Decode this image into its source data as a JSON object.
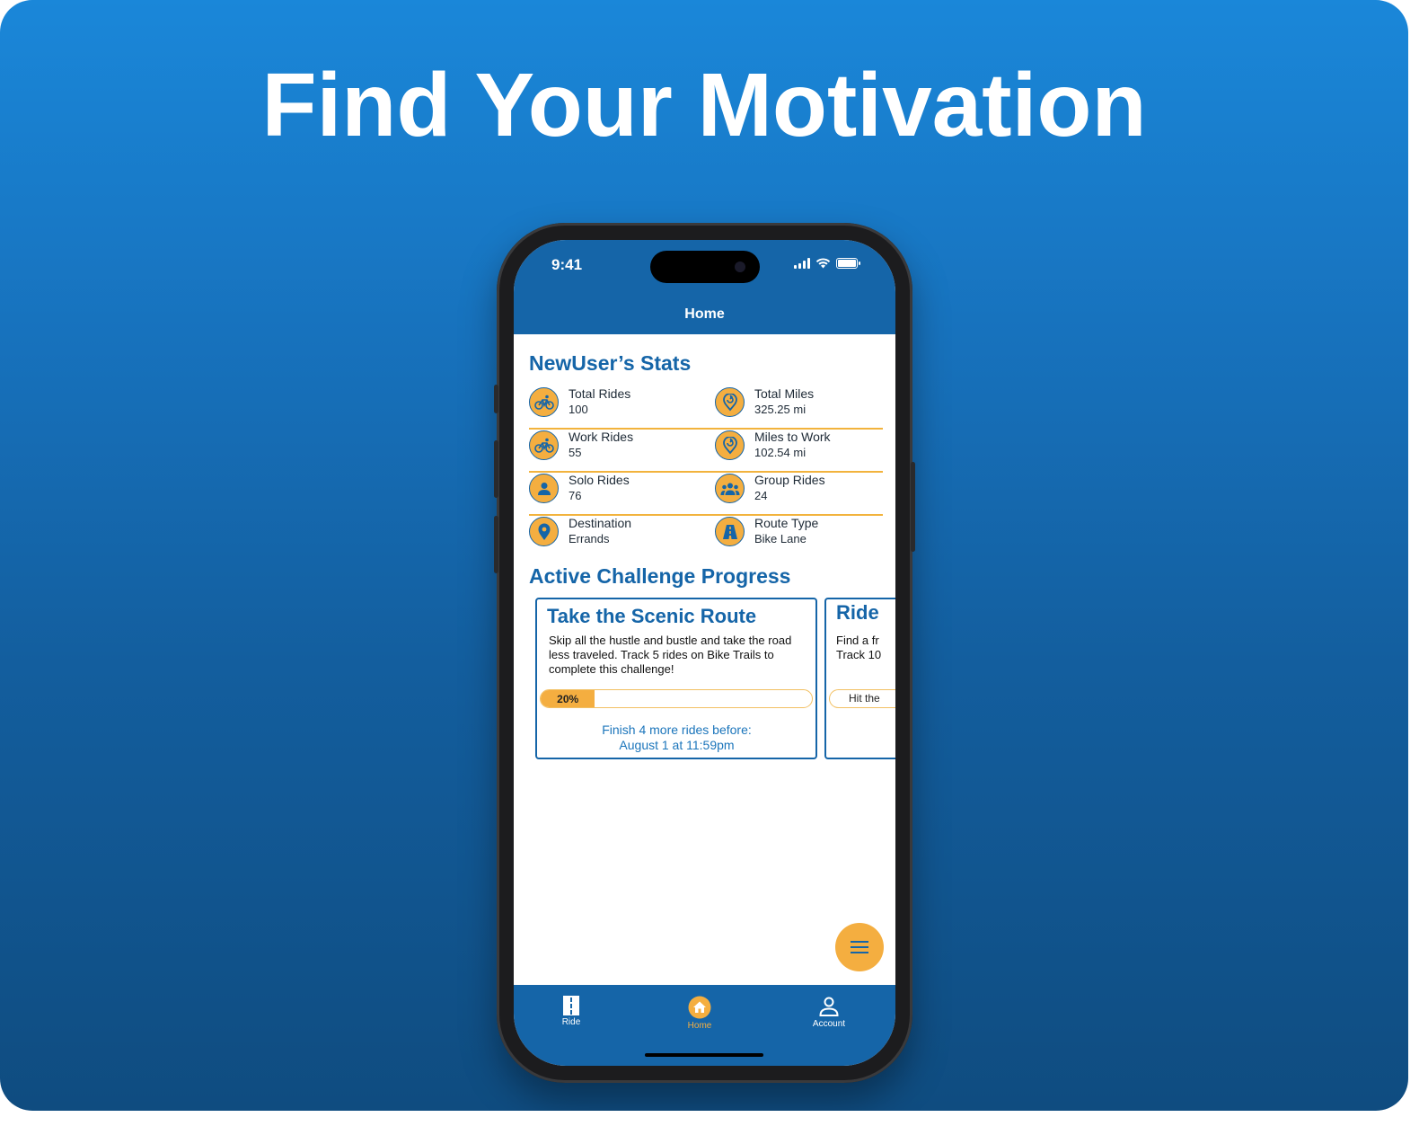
{
  "headline": "Find Your Motivation",
  "status_bar": {
    "time": "9:41"
  },
  "nav": {
    "title": "Home"
  },
  "stats": {
    "title": "NewUser’s Stats",
    "items": [
      {
        "label": "Total Rides",
        "value": "100",
        "icon": "bike-icon"
      },
      {
        "label": "Total Miles",
        "value": "325.25 mi",
        "icon": "location-refresh-icon"
      },
      {
        "label": "Work Rides",
        "value": "55",
        "icon": "bike-icon"
      },
      {
        "label": "Miles to Work",
        "value": "102.54 mi",
        "icon": "location-refresh-icon"
      },
      {
        "label": "Solo Rides",
        "value": "76",
        "icon": "person-icon"
      },
      {
        "label": "Group Rides",
        "value": "24",
        "icon": "group-icon"
      },
      {
        "label": "Destination",
        "value": "Errands",
        "icon": "map-pin-icon"
      },
      {
        "label": "Route Type",
        "value": "Bike Lane",
        "icon": "road-icon"
      }
    ]
  },
  "challenges": {
    "title": "Active Challenge Progress",
    "cards": [
      {
        "title": "Take the Scenic Route",
        "description": "Skip all the hustle and bustle and take the road less traveled. Track 5 rides on Bike Trails to complete this challenge!",
        "progress_label": "20%",
        "progress": 0.2,
        "footer_line1": "Finish 4 more rides before:",
        "footer_line2": "August 1 at 11:59pm"
      },
      {
        "title": "Ride",
        "description_line1": "Find a fr",
        "description_line2": "Track 10",
        "progress_label": "Hit the"
      }
    ]
  },
  "tabs": [
    {
      "label": "Ride",
      "icon": "road-icon"
    },
    {
      "label": "Home",
      "icon": "home-icon",
      "active": true
    },
    {
      "label": "Account",
      "icon": "account-icon"
    }
  ],
  "colors": {
    "primary": "#1565a8",
    "accent": "#f4ae40",
    "background_top": "#1a87d9",
    "background_bottom": "#0f4c80"
  }
}
